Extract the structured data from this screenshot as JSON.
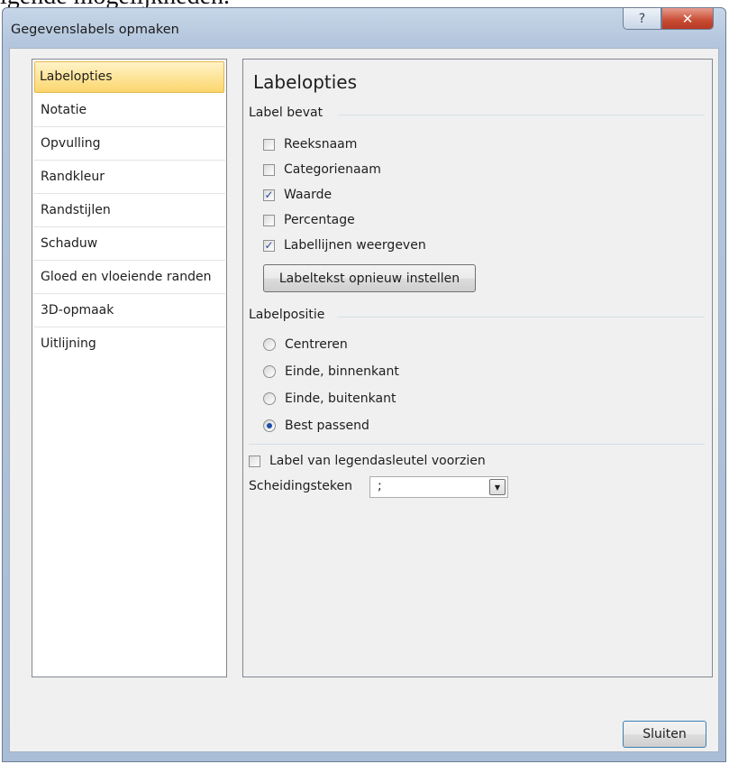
{
  "background_text": "lgende mogelijkheden.",
  "window": {
    "title": "Gegevenslabels opmaken",
    "help_glyph": "?",
    "close_glyph": "✕"
  },
  "nav": {
    "items": [
      {
        "label": "Labelopties",
        "selected": true
      },
      {
        "label": "Notatie"
      },
      {
        "label": "Opvulling"
      },
      {
        "label": "Randkleur"
      },
      {
        "label": "Randstijlen"
      },
      {
        "label": "Schaduw"
      },
      {
        "label": "Gloed en vloeiende randen"
      },
      {
        "label": "3D-opmaak"
      },
      {
        "label": "Uitlijning"
      }
    ]
  },
  "content": {
    "heading": "Labelopties",
    "label_contains": {
      "title": "Label bevat",
      "options": [
        {
          "label": "Reeksnaam",
          "checked": false
        },
        {
          "label": "Categorienaam",
          "checked": false
        },
        {
          "label": "Waarde",
          "checked": true
        },
        {
          "label": "Percentage",
          "checked": false
        },
        {
          "label": "Labellijnen weergeven",
          "checked": true
        }
      ],
      "reset_button": "Labeltekst opnieuw instellen"
    },
    "label_position": {
      "title": "Labelpositie",
      "options": [
        {
          "label": "Centreren",
          "selected": false
        },
        {
          "label": "Einde, binnenkant",
          "selected": false
        },
        {
          "label": "Einde, buitenkant",
          "selected": false
        },
        {
          "label": "Best passend",
          "selected": true
        }
      ]
    },
    "legend_key": {
      "label": "Label van legendasleutel voorzien",
      "checked": false
    },
    "separator": {
      "label": "Scheidingsteken",
      "value": ";"
    }
  },
  "footer": {
    "close_button": "Sluiten"
  },
  "colors": {
    "selected_item": "#fcd66d",
    "check_mark": "#2b4a9a",
    "radio_dot": "#1f4ea8"
  }
}
